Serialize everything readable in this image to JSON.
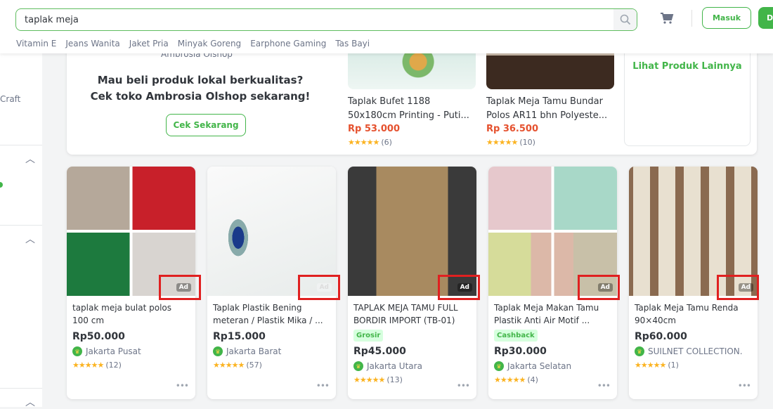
{
  "header": {
    "search": {
      "value": "taplak meja",
      "icon": "search-icon"
    },
    "suggestions": [
      "Vitamin E",
      "Jeans Wanita",
      "Jaket Pria",
      "Minyak Goreng",
      "Earphone Gaming",
      "Tas Bayi"
    ],
    "cart_icon": "cart-icon",
    "login_label": "Masuk",
    "register_label": "D"
  },
  "sidebar": {
    "craft_label": "Craft"
  },
  "top_ad": {
    "shop_name": "Ambrosia Olshop",
    "headline": "Mau beli produk lokal berkualitas? Cek toko Ambrosia Olshop sekarang!",
    "cta_label": "Cek Sekarang",
    "products": [
      {
        "title": "Taplak Bufet 1188 50x180cm Printing - Puti...",
        "price": "Rp 53.000",
        "rating_count": "(6)"
      },
      {
        "title": "Taplak Meja Tamu Bundar Polos AR11 bhn Polyeste...",
        "price": "Rp 36.500",
        "rating_count": "(10)"
      }
    ],
    "more_label": "Lihat Produk Lainnya"
  },
  "products": [
    {
      "title": "taplak meja bulat polos 100 cm",
      "price": "Rp50.000",
      "location": "Jakarta Pusat",
      "rating_count": "(12)",
      "badge": "",
      "ad": "Ad"
    },
    {
      "title": "Taplak Plastik Bening meteran / Plastik Mika / ...",
      "price": "Rp15.000",
      "location": "Jakarta Barat",
      "rating_count": "(57)",
      "badge": "",
      "ad": "Ad"
    },
    {
      "title": "TAPLAK MEJA TAMU FULL BORDIR IMPORT (TB-01)",
      "price": "Rp45.000",
      "location": "Jakarta Utara",
      "rating_count": "(13)",
      "badge": "Grosir",
      "ad": "Ad"
    },
    {
      "title": "Taplak Meja Makan Tamu Plastik Anti Air Motif ...",
      "price": "Rp30.000",
      "location": "Jakarta Selatan",
      "rating_count": "(4)",
      "badge": "Cashback",
      "ad": "Ad"
    },
    {
      "title": "Taplak Meja Tamu Renda 90×40cm",
      "price": "Rp60.000",
      "location": "SUILNET COLLECTION.",
      "rating_count": "(1)",
      "badge": "",
      "ad": "Ad"
    }
  ],
  "stars": "★★★★★",
  "colors": {
    "brand": "#42b549",
    "price_red": "#e5512e",
    "star": "#fbb321",
    "highlight_box": "#e02020"
  }
}
